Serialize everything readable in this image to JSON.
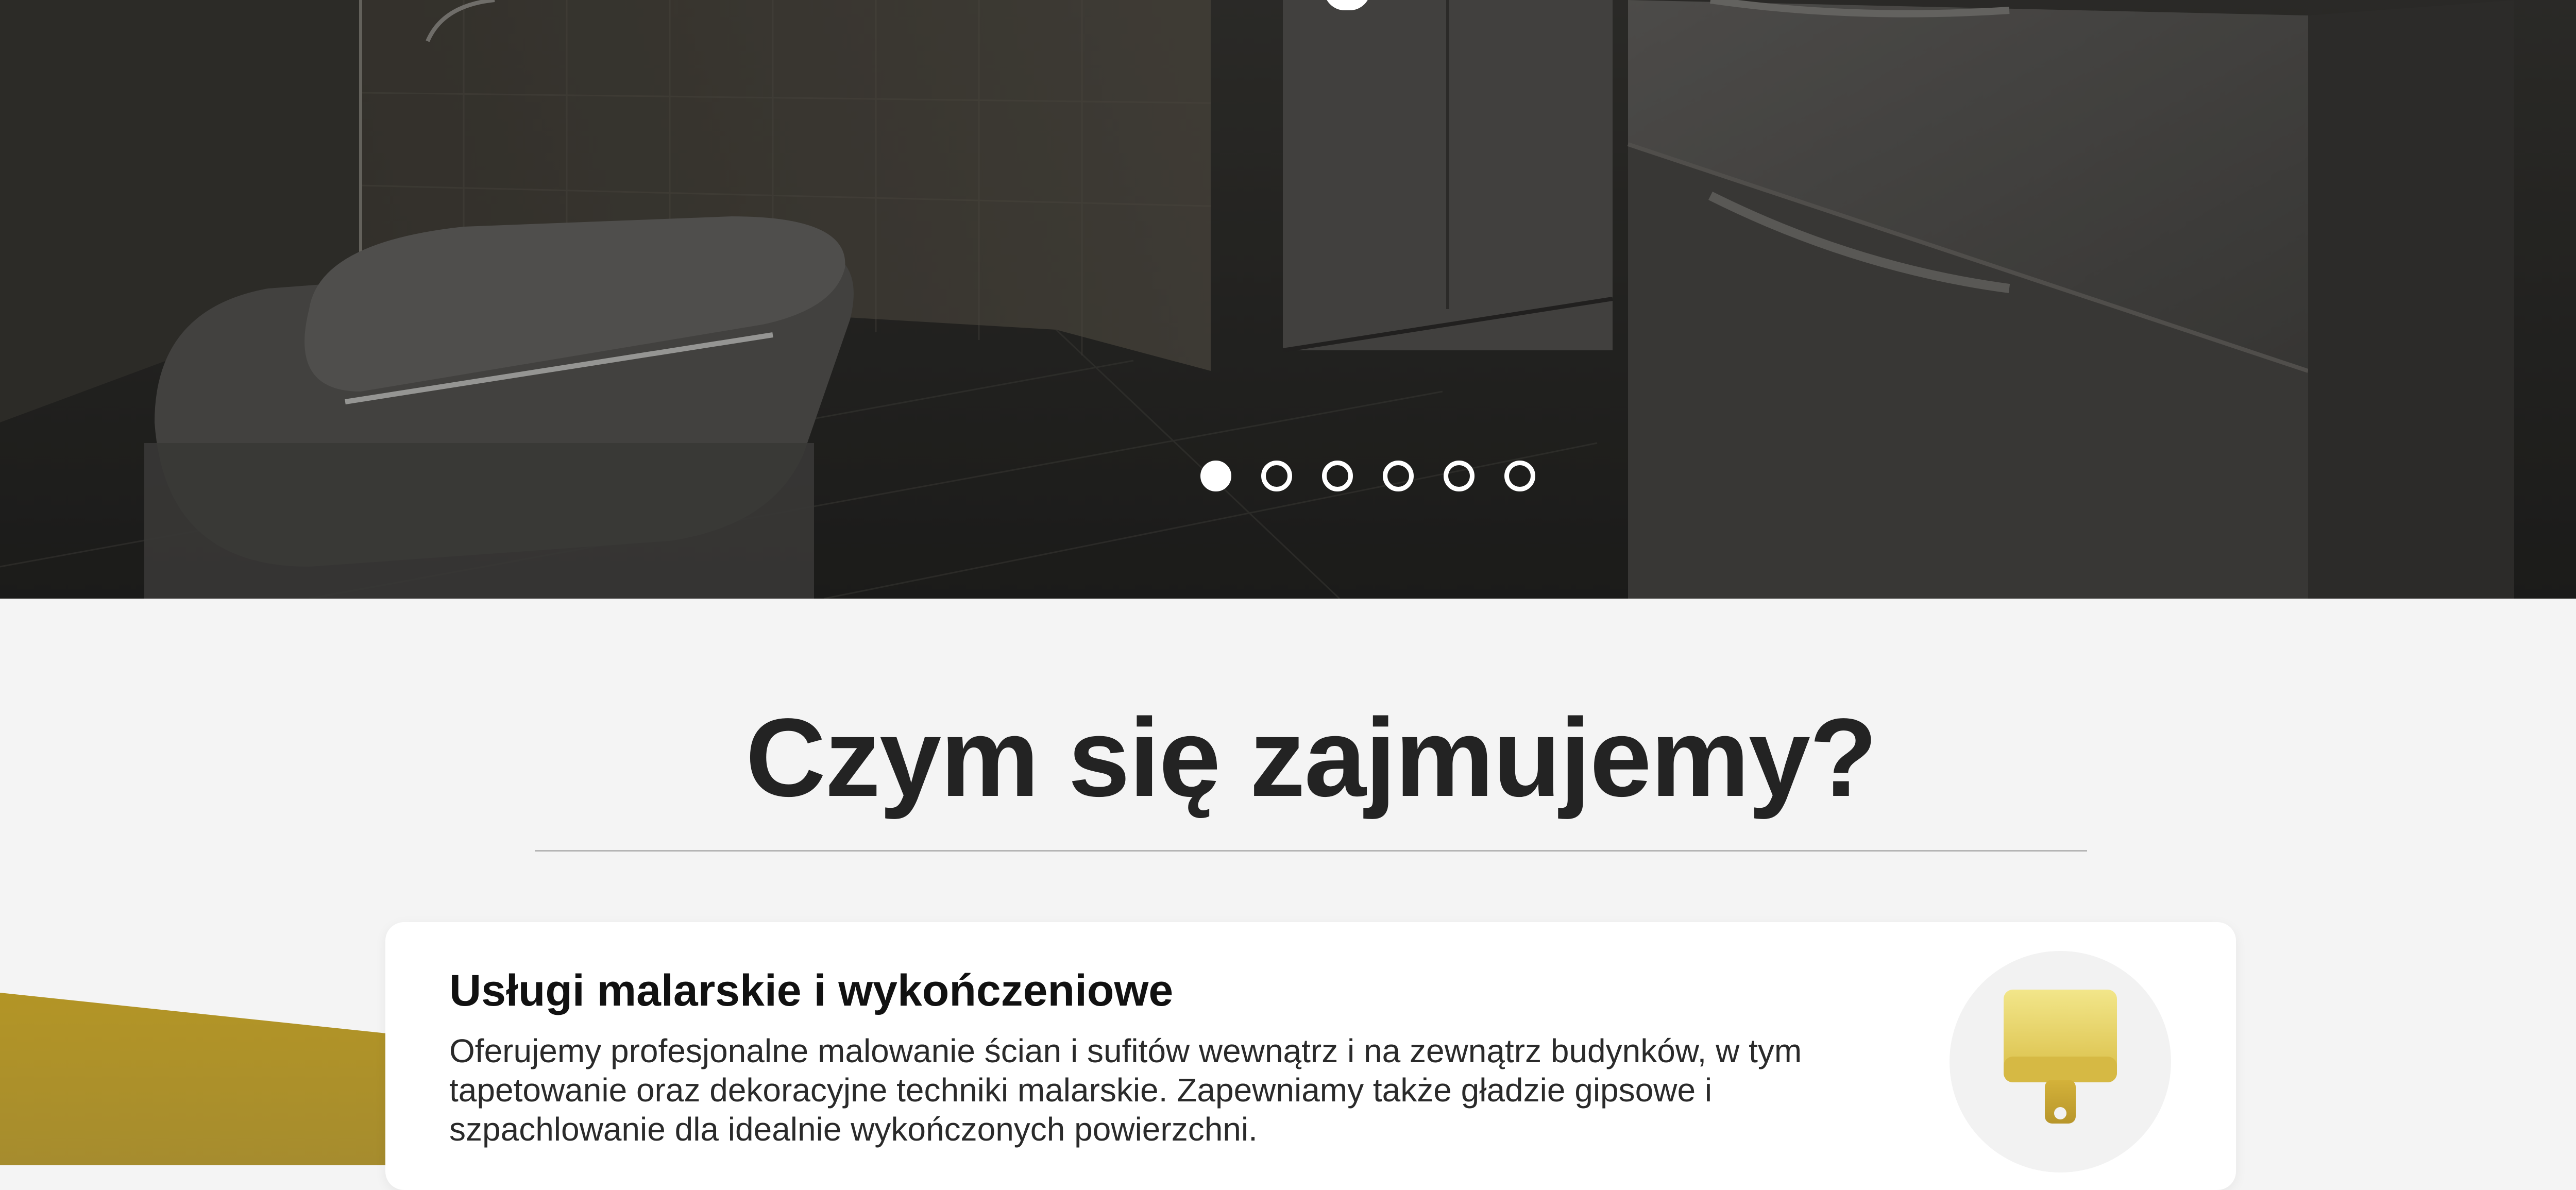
{
  "hero": {
    "carousel": {
      "slide_count": 6,
      "active_index": 0
    }
  },
  "services_section": {
    "title": "Czym się zajmujemy?",
    "cards": [
      {
        "title": "Usługi malarskie i wykończeniowe",
        "description": "Oferujemy profesjonalne malowanie ścian i sufitów wewnątrz i na zewnątrz budynków, w tym tapetowanie oraz dekoracyjne techniki malarskie. Zapewniamy także gładzie gipsowe i szpachlowanie dla idealnie wykończonych powierzchni.",
        "icon": "paint-brush-icon"
      }
    ]
  },
  "colors": {
    "accent_gold": "#B0962A",
    "icon_gold_light": "#F0E17A",
    "icon_gold_dark": "#D4B23A"
  }
}
